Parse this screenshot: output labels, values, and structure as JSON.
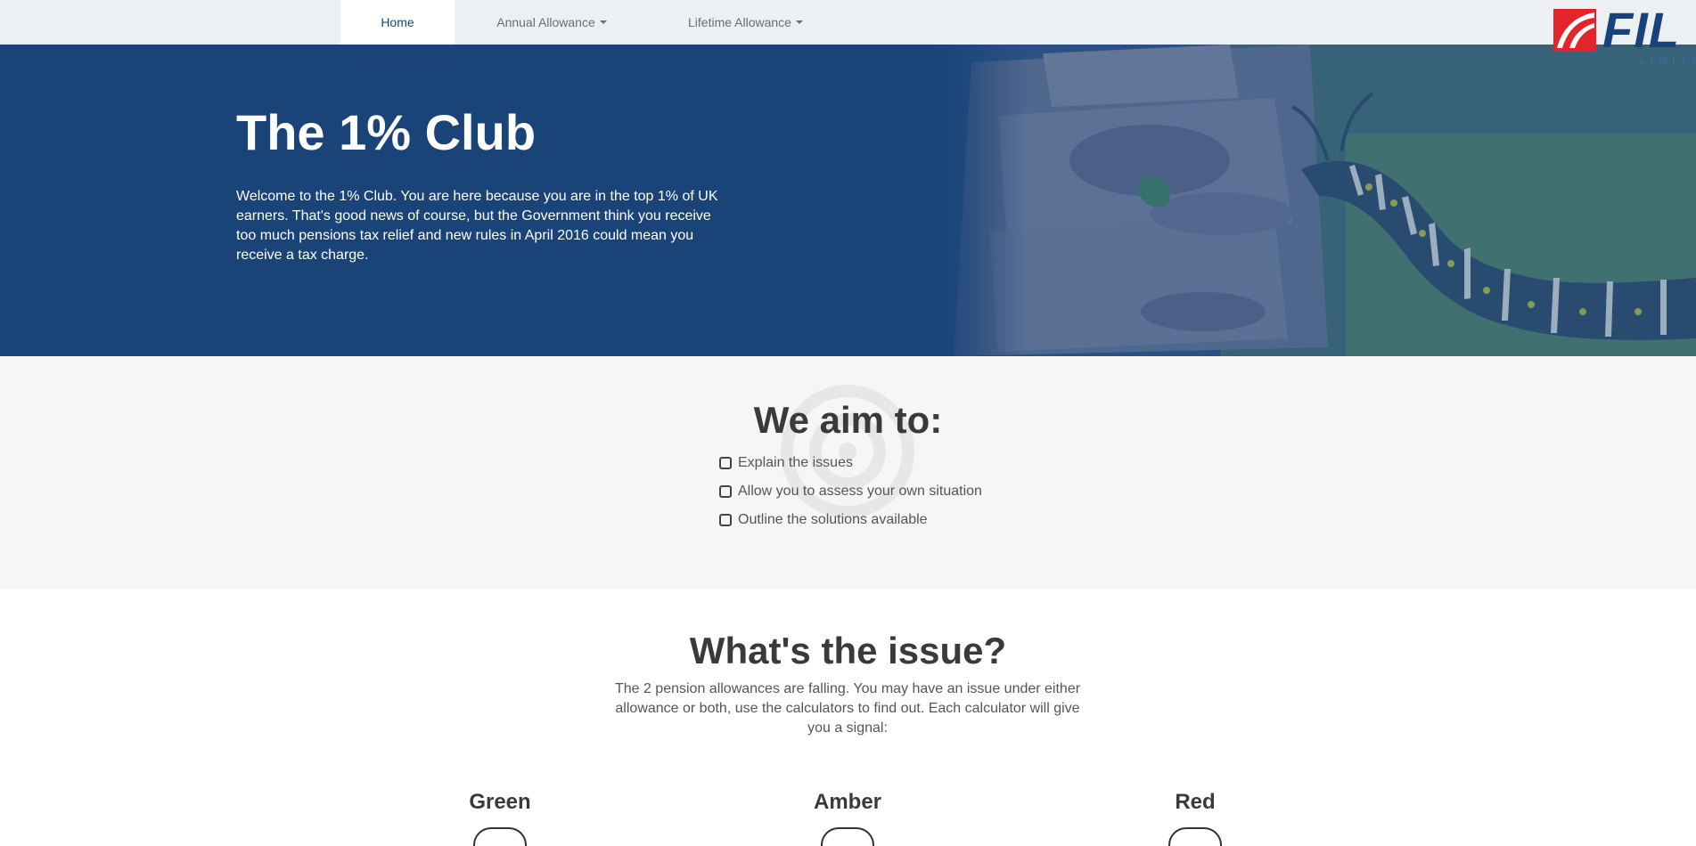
{
  "nav": {
    "items": [
      {
        "label": "Home",
        "active": true
      },
      {
        "label": "Annual Allowance",
        "dropdown": true
      },
      {
        "label": "Lifetime Allowance",
        "dropdown": true
      }
    ]
  },
  "logo": {
    "text": "FIL",
    "sub": "LIMITED"
  },
  "hero": {
    "title": "The 1% Club",
    "text": "Welcome to the 1% Club. You are here because you are in the top 1% of UK earners. That's good news of course, but the Government think you receive too much pensions tax relief and new rules in April 2016 could mean you receive a tax charge."
  },
  "aims": {
    "title": "We aim to:",
    "items": [
      "Explain the issues",
      "Allow you to assess your own situation",
      "Outline the solutions available"
    ]
  },
  "issue": {
    "title": "What's the issue?",
    "text": "The 2 pension allowances are falling. You may have an issue under either allowance or both, use the calculators to find out. Each calculator will give you a signal:",
    "signals": [
      "Green",
      "Amber",
      "Red"
    ]
  },
  "colors": {
    "brand_blue": "#1a4478",
    "logo_red": "#e3242b",
    "nav_bg": "#edf0f3",
    "aims_bg": "#f6f6f6"
  }
}
